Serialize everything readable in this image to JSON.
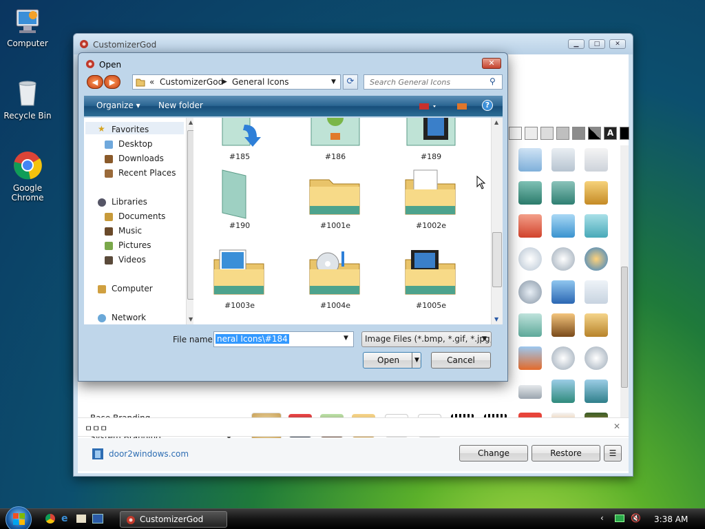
{
  "desktop": {
    "icons": [
      {
        "label": "Computer"
      },
      {
        "label": "Recycle Bin"
      },
      {
        "label": "Google Chrome"
      }
    ]
  },
  "main_window": {
    "title": "CustomizerGod",
    "categories": [
      "Base Branding",
      "System Branding"
    ],
    "notification_text": "ㅁㅁㅁ",
    "link_text": "door2windows.com",
    "buttons": {
      "change": "Change",
      "restore": "Restore",
      "menu": "☰"
    }
  },
  "open_dialog": {
    "title": "Open",
    "breadcrumb": {
      "prefix": "«",
      "items": [
        "CustomizerGod",
        "General Icons"
      ]
    },
    "search_placeholder": "Search General Icons",
    "toolbar": {
      "organize": "Organize ▾",
      "new_folder": "New folder"
    },
    "nav": {
      "favorites": "Favorites",
      "desktop": "Desktop",
      "downloads": "Downloads",
      "recent": "Recent Places",
      "libraries": "Libraries",
      "documents": "Documents",
      "music": "Music",
      "pictures": "Pictures",
      "videos": "Videos",
      "computer": "Computer",
      "network": "Network"
    },
    "files": [
      "#185",
      "#186",
      "#189",
      "#190",
      "#1001e",
      "#1002e",
      "#1003e",
      "#1004e",
      "#1005e"
    ],
    "file_name_label": "File name:",
    "file_name_value": "neral Icons\\#184",
    "file_type": "Image Files (*.bmp, *.gif, *.jpg,",
    "open_button": "Open",
    "cancel_button": "Cancel"
  },
  "taskbar": {
    "task_label": "CustomizerGod",
    "clock": "3:38 AM"
  }
}
